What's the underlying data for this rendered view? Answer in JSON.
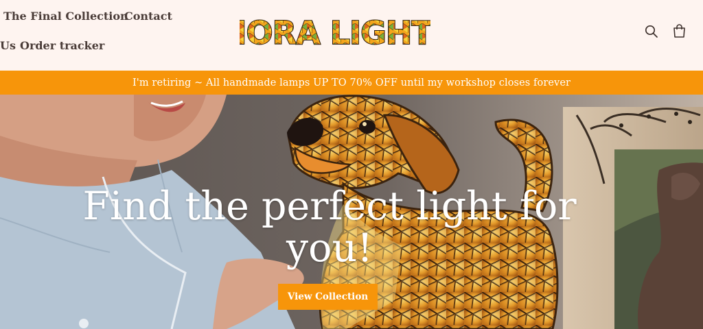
{
  "header": {
    "nav": {
      "final_collection": "The Final Collection",
      "contact": "Contact",
      "about_partial": "Us",
      "order_tracker": "Order tracker"
    },
    "logo_text": "LIORA LIGHTS",
    "icons": [
      "search-icon",
      "cart-icon"
    ]
  },
  "announcement": {
    "text": "I'm retiring ~ All handmade lamps UP TO 70% OFF until my workshop closes forever"
  },
  "hero": {
    "title": "Find the perfect light for you!",
    "button_label": "View Collection"
  },
  "colors": {
    "accent": "#f7950a",
    "header_bg": "#fef4f0",
    "nav_text": "#4a3c38",
    "logo_outline": "#2a1d10",
    "logo_fill": "#f2a21b"
  }
}
